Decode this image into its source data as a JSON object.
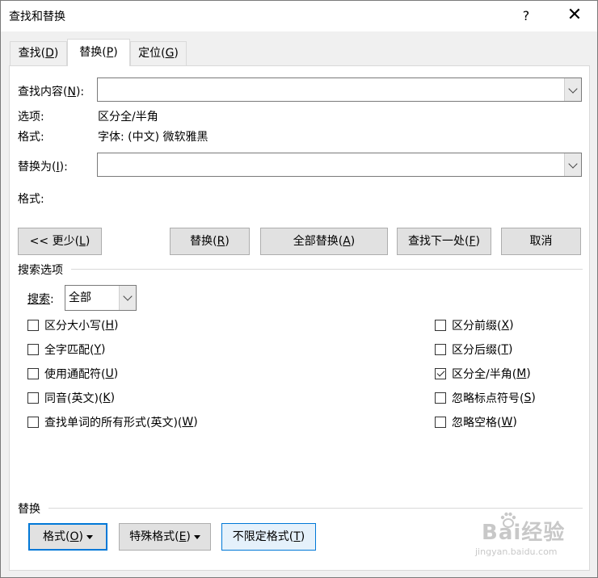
{
  "window": {
    "title": "查找和替换",
    "help_glyph": "?",
    "close_glyph": "✕"
  },
  "tabs": [
    {
      "label_pre": "查找(",
      "key": "D",
      "label_post": ")"
    },
    {
      "label_pre": "替换(",
      "key": "P",
      "label_post": ")",
      "active": true
    },
    {
      "label_pre": "定位(",
      "key": "G",
      "label_post": ")"
    }
  ],
  "find": {
    "label_pre": "查找内容(",
    "key": "N",
    "label_post": "):",
    "value": "",
    "options_label": "选项:",
    "options_value": "区分全/半角",
    "format_label": "格式:",
    "format_value": "字体: (中文) 微软雅黑"
  },
  "replace": {
    "label_pre": "替换为(",
    "key": "I",
    "label_post": "):",
    "value": "",
    "format_label": "格式:"
  },
  "buttons": {
    "less": {
      "pre": "<< 更少(",
      "key": "L",
      "post": ")"
    },
    "replace": {
      "pre": "替换(",
      "key": "R",
      "post": ")"
    },
    "replace_all": {
      "pre": "全部替换(",
      "key": "A",
      "post": ")"
    },
    "find_next": {
      "pre": "查找下一处(",
      "key": "F",
      "post": ")"
    },
    "cancel": {
      "label": "取消"
    }
  },
  "search_options": {
    "heading": "搜索选项",
    "search_label_pre": "搜索",
    "search_label_post": ":",
    "search_value": "全部",
    "left": [
      {
        "pre": "区分大小写(",
        "key": "H",
        "post": ")",
        "checked": false
      },
      {
        "pre": "全字匹配(",
        "key": "Y",
        "post": ")",
        "checked": false
      },
      {
        "pre": "使用通配符(",
        "key": "U",
        "post": ")",
        "checked": false
      },
      {
        "pre": "同音(英文)(",
        "key": "K",
        "post": ")",
        "checked": false
      },
      {
        "pre": "查找单词的所有形式(英文)(",
        "key": "W",
        "post": ")",
        "checked": false
      }
    ],
    "right": [
      {
        "pre": "区分前缀(",
        "key": "X",
        "post": ")",
        "checked": false
      },
      {
        "pre": "区分后缀(",
        "key": "T",
        "post": ")",
        "checked": false
      },
      {
        "pre": "区分全/半角(",
        "key": "M",
        "post": ")",
        "checked": true
      },
      {
        "pre": "忽略标点符号(",
        "key": "S",
        "post": ")",
        "checked": false
      },
      {
        "pre": "忽略空格(",
        "key": "W",
        "post": ")",
        "checked": false
      }
    ]
  },
  "replace_section": {
    "heading": "替换",
    "format_btn": {
      "pre": "格式(",
      "key": "O",
      "post": ")"
    },
    "special_btn": {
      "pre": "特殊格式(",
      "key": "E",
      "post": ")"
    },
    "no_format_btn": {
      "pre": "不限定格式(",
      "key": "T",
      "post": ")"
    }
  },
  "watermark": {
    "text": "Bai经验",
    "sub": "jingyan.baidu.com"
  }
}
